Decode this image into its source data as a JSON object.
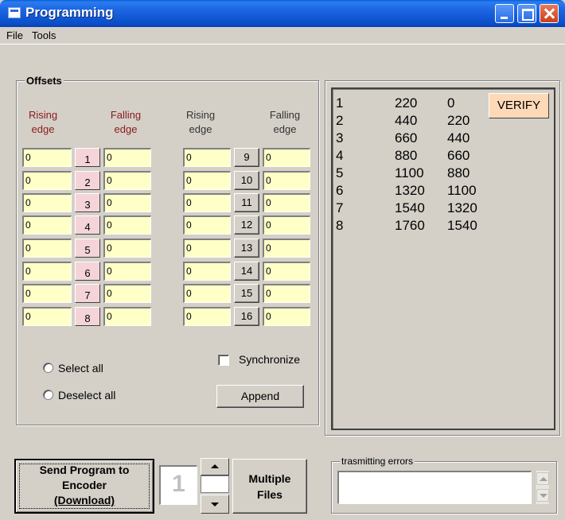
{
  "window": {
    "title": "Programming"
  },
  "menu": {
    "file": "File",
    "tools": "Tools"
  },
  "offsets": {
    "legend": "Offsets",
    "headers": {
      "rising_1": "Rising edge",
      "falling_1": "Falling edge",
      "rising_2": "Rising edge",
      "falling_2": "Falling edge"
    },
    "rows": [
      {
        "num": "1",
        "rising": "0",
        "falling": "0"
      },
      {
        "num": "2",
        "rising": "0",
        "falling": "0"
      },
      {
        "num": "3",
        "rising": "0",
        "falling": "0"
      },
      {
        "num": "4",
        "rising": "0",
        "falling": "0"
      },
      {
        "num": "5",
        "rising": "0",
        "falling": "0"
      },
      {
        "num": "6",
        "rising": "0",
        "falling": "0"
      },
      {
        "num": "7",
        "rising": "0",
        "falling": "0"
      },
      {
        "num": "8",
        "rising": "0",
        "falling": "0"
      },
      {
        "num": "9",
        "rising": "0",
        "falling": "0"
      },
      {
        "num": "10",
        "rising": "0",
        "falling": "0"
      },
      {
        "num": "11",
        "rising": "0",
        "falling": "0"
      },
      {
        "num": "12",
        "rising": "0",
        "falling": "0"
      },
      {
        "num": "13",
        "rising": "0",
        "falling": "0"
      },
      {
        "num": "14",
        "rising": "0",
        "falling": "0"
      },
      {
        "num": "15",
        "rising": "0",
        "falling": "0"
      },
      {
        "num": "16",
        "rising": "0",
        "falling": "0"
      }
    ],
    "select_all": "Select all",
    "deselect_all": "Deselect all",
    "synchronize": "Synchronize",
    "append": "Append"
  },
  "program_list": {
    "verify": "VERIFY",
    "rows": [
      [
        "1",
        "220",
        "0"
      ],
      [
        "2",
        "440",
        "220"
      ],
      [
        "3",
        "660",
        "440"
      ],
      [
        "4",
        "880",
        "660"
      ],
      [
        "5",
        "1100",
        "880"
      ],
      [
        "6",
        "1320",
        "1100"
      ],
      [
        "7",
        "1540",
        "1320"
      ],
      [
        "8",
        "1760",
        "1540"
      ]
    ]
  },
  "bottom": {
    "send_line1": "Send Program to",
    "send_line2": "Encoder",
    "send_line3": "(Download)",
    "counter_value": "1",
    "multiple_line1": "Multiple",
    "multiple_line2": "Files",
    "errors_legend": "trasmitting errors",
    "errors_text": ""
  }
}
